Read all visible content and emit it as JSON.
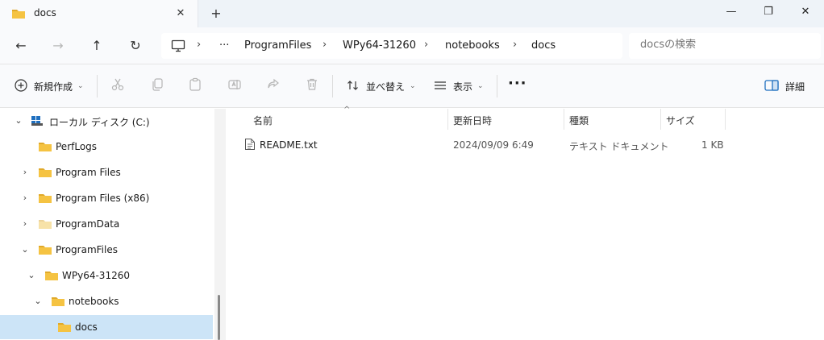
{
  "window": {
    "tab_title": "docs",
    "tab_close": "✕",
    "new_tab": "+",
    "minimize": "—",
    "maximize": "❐",
    "close": "✕"
  },
  "nav": {
    "back": "←",
    "forward": "→",
    "up": "↑",
    "refresh": "↻"
  },
  "address": {
    "overflow": "···",
    "separator": "›",
    "crumbs": [
      "ProgramFiles",
      "WPy64-31260",
      "notebooks",
      "docs"
    ]
  },
  "search": {
    "placeholder": "docsの検索"
  },
  "toolbar": {
    "new_label": "新規作成",
    "sort_label": "並べ替え",
    "view_label": "表示",
    "more_label": "···",
    "details_label": "詳細",
    "chevron": "⌄"
  },
  "sidebar": {
    "items": [
      {
        "label": "ローカル ディスク (C:)",
        "chevron": "⌄",
        "icon": "drive-icon"
      },
      {
        "label": "PerfLogs",
        "chevron": "",
        "icon": "folder-icon"
      },
      {
        "label": "Program Files",
        "chevron": "›",
        "icon": "folder-icon"
      },
      {
        "label": "Program Files (x86)",
        "chevron": "›",
        "icon": "folder-icon"
      },
      {
        "label": "ProgramData",
        "chevron": "›",
        "icon": "folder-icon"
      },
      {
        "label": "ProgramFiles",
        "chevron": "⌄",
        "icon": "folder-icon"
      },
      {
        "label": "WPy64-31260",
        "chevron": "⌄",
        "icon": "folder-icon"
      },
      {
        "label": "notebooks",
        "chevron": "⌄",
        "icon": "folder-icon"
      },
      {
        "label": "docs",
        "chevron": "",
        "icon": "folder-icon"
      }
    ]
  },
  "list": {
    "columns": {
      "name": "名前",
      "modified": "更新日時",
      "type": "種類",
      "size": "サイズ"
    },
    "sort_caret": "^",
    "files": [
      {
        "name": "README.txt",
        "modified": "2024/09/09 6:49",
        "type": "テキスト ドキュメント",
        "size": "1 KB"
      }
    ]
  },
  "colors": {
    "folder": "#f5c342",
    "folder_dark": "#e0a92a",
    "selected": "#cce4f7",
    "accent": "#1f6fbf"
  }
}
